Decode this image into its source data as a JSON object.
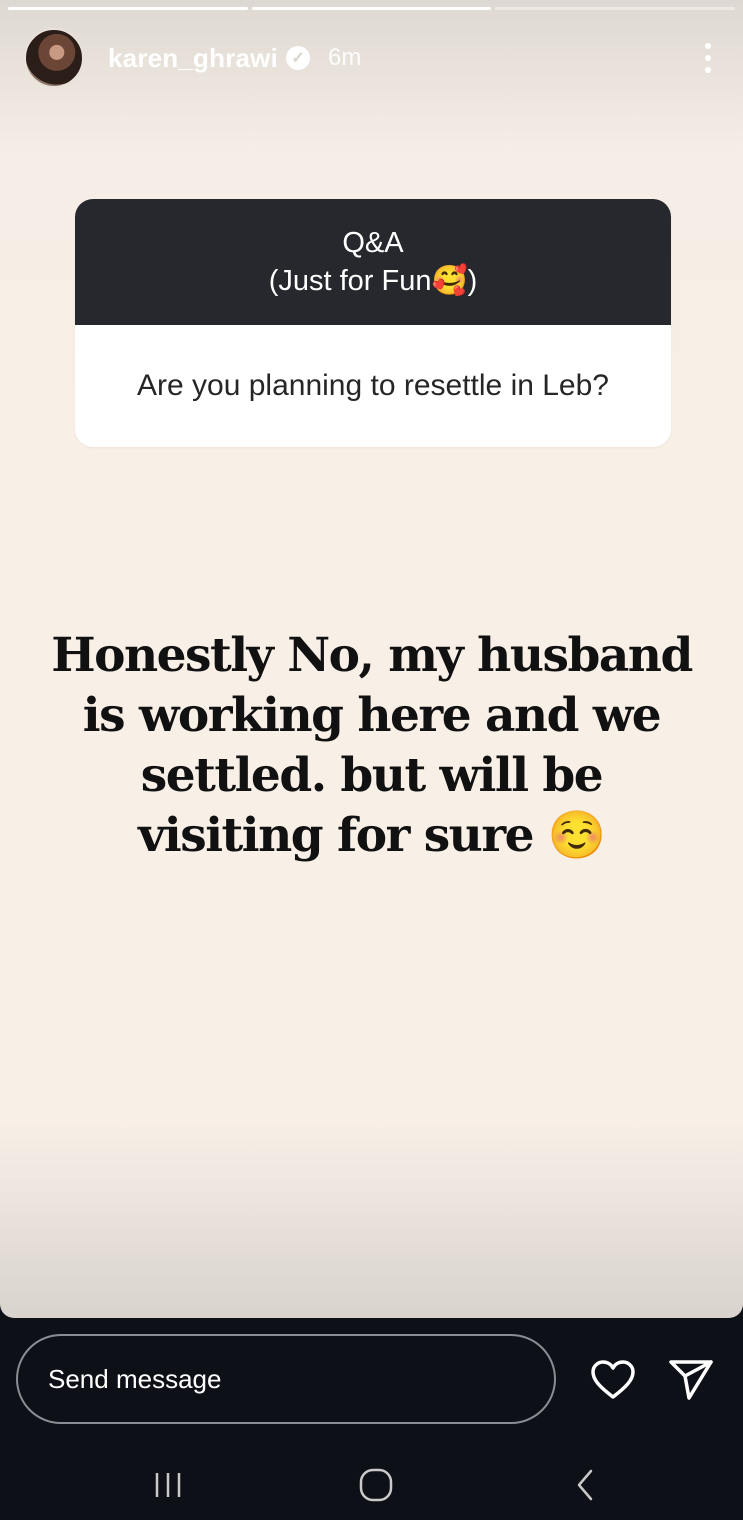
{
  "story": {
    "progress_segments": [
      {
        "state": "done"
      },
      {
        "state": "done"
      },
      {
        "state": "pending"
      }
    ],
    "header": {
      "username": "karen_ghrawi",
      "verified_icon": "verified-badge-icon",
      "time": "6m",
      "more_icon": "more-vertical-icon"
    },
    "qa_card": {
      "title": "Q&A",
      "subtitle": "(Just for Fun🥰)",
      "question": "Are you planning to resettle in Leb?"
    },
    "answer": {
      "line1": "Honestly No, my husband",
      "line2": "is working here and we",
      "line3": "settled. but will be",
      "line4": "visiting for sure ☺️"
    }
  },
  "reply_bar": {
    "placeholder": "Send message",
    "like_icon": "heart-icon",
    "share_icon": "send-icon"
  },
  "system_nav": {
    "recent_icon": "recent-apps-icon",
    "home_icon": "home-icon",
    "back_icon": "back-icon"
  },
  "colors": {
    "story_background": "#f8efe7",
    "qa_header": "#26282d",
    "app_bar": "#0d1016"
  }
}
